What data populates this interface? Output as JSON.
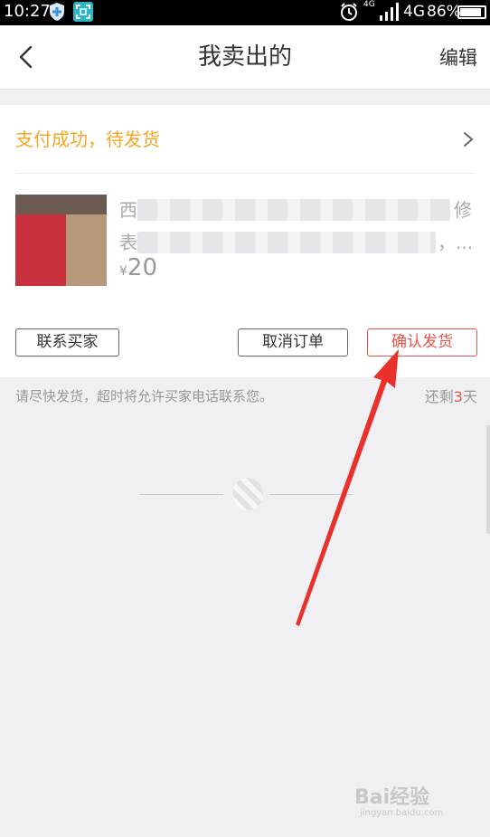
{
  "status_bar": {
    "time": "10:27",
    "network_small": "4G",
    "network": "4G",
    "battery": "86%",
    "icons": [
      "shield-icon",
      "scan-icon",
      "alarm-icon",
      "signal-icon",
      "battery-icon"
    ]
  },
  "nav": {
    "title": "我卖出的",
    "edit_label": "编辑",
    "back_icon": "chevron-left-icon"
  },
  "order": {
    "status_text": "支付成功，待发货",
    "desc_first_char_line1": "西",
    "desc_last_char_line1": "修",
    "desc_first_char_line2": "表",
    "desc_tail_line2": "，...",
    "price_symbol": "¥",
    "price_value": "20",
    "buttons": {
      "contact": "联系买家",
      "cancel": "取消订单",
      "confirm": "确认发货"
    }
  },
  "hint": {
    "text": "请尽快发货，超时将允许买家电话联系您。",
    "days_prefix": "还剩",
    "days_value": "3",
    "days_suffix": "天"
  },
  "watermark": {
    "main": "Bai",
    "main_cn": "经验",
    "sub": "jingyan.baidu.com"
  },
  "colors": {
    "status_orange": "#f5a623",
    "accent_red": "#e8544a",
    "background": "#f0f0f4"
  }
}
